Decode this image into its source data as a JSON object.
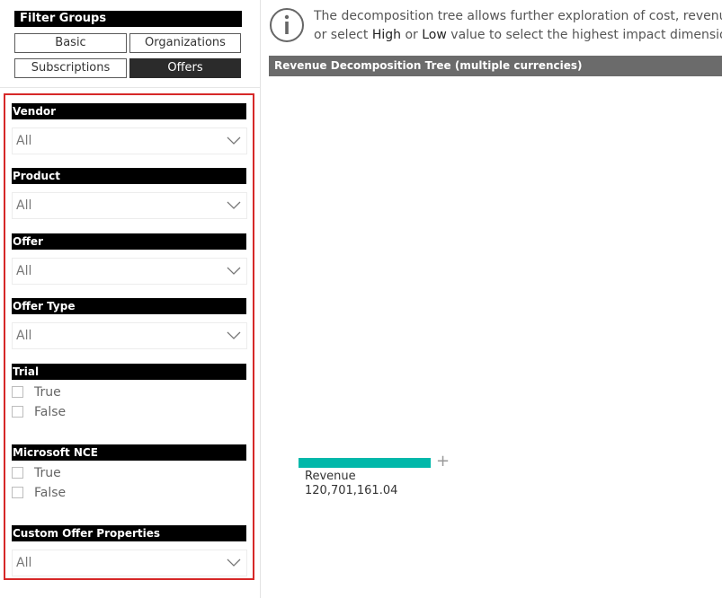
{
  "filter_groups": {
    "title": "Filter Groups",
    "buttons": [
      {
        "label": "Basic",
        "active": false
      },
      {
        "label": "Organizations",
        "active": false
      },
      {
        "label": "Subscriptions",
        "active": false
      },
      {
        "label": "Offers",
        "active": true
      }
    ]
  },
  "filters": {
    "vendor": {
      "title": "Vendor",
      "value": "All"
    },
    "product": {
      "title": "Product",
      "value": "All"
    },
    "offer": {
      "title": "Offer",
      "value": "All"
    },
    "offer_type": {
      "title": "Offer Type",
      "value": "All"
    },
    "trial": {
      "title": "Trial",
      "options": [
        "True",
        "False"
      ]
    },
    "microsoft_nce": {
      "title": "Microsoft NCE",
      "options": [
        "True",
        "False"
      ]
    },
    "custom_offer_properties": {
      "title": "Custom Offer Properties",
      "value": "All"
    }
  },
  "info": {
    "line1": "The decomposition tree allows further exploration of cost, revenue and profit",
    "line2_pre": "or select ",
    "high": "High",
    "mid": " or ",
    "low": "Low",
    "line2_post": " value to select the highest impact dimensions and values"
  },
  "tree": {
    "title": "Revenue Decomposition Tree (multiple currencies)",
    "root_label": "Revenue",
    "root_value": "120,701,161.04",
    "bar_color": "#01b8aa",
    "expand_symbol": "+"
  },
  "colors": {
    "panel_border": "#d62828",
    "header_bg": "#000000",
    "tree_header_bg": "#6b6b6b"
  }
}
